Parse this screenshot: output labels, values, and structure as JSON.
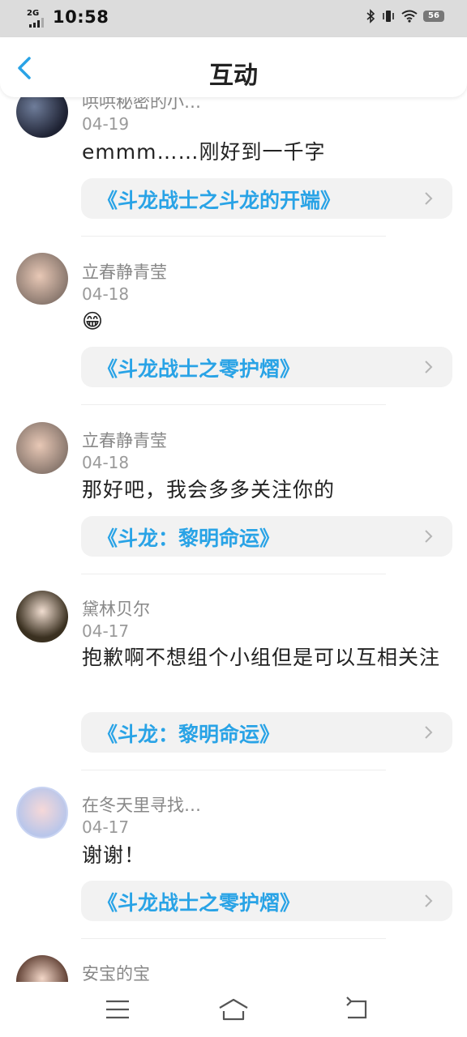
{
  "status": {
    "network": "2G",
    "time": "10:58",
    "battery": "56"
  },
  "header": {
    "title": "互动"
  },
  "icons": {
    "back": "chevron-left-icon",
    "next": "chevron-right-icon",
    "menu": "menu-icon",
    "home": "home-icon",
    "return": "back-icon"
  },
  "colors": {
    "accent": "#29a3e6",
    "book_bg": "#f2f2f2",
    "muted": "#888888"
  },
  "comments": [
    {
      "name": "哄哄秘密的小…",
      "date": "04-19",
      "text": "emmm……刚好到一千字",
      "book": "《斗龙战士之斗龙的开端》"
    },
    {
      "name": "立春静青莹",
      "date": "04-18",
      "text": "😁",
      "book": "《斗龙战士之零护熠》"
    },
    {
      "name": "立春静青莹",
      "date": "04-18",
      "text": "那好吧，我会多多关注你的",
      "book": "《斗龙：黎明命运》"
    },
    {
      "name": "黛林贝尔",
      "date": "04-17",
      "text": "抱歉啊不想组个小组但是可以互相关注",
      "book": "《斗龙：黎明命运》"
    },
    {
      "name": "在冬天里寻找…",
      "date": "04-17",
      "text": "谢谢！",
      "book": "《斗龙战士之零护熠》"
    },
    {
      "name": "安宝的宝",
      "date": "",
      "text": "",
      "book": ""
    }
  ]
}
